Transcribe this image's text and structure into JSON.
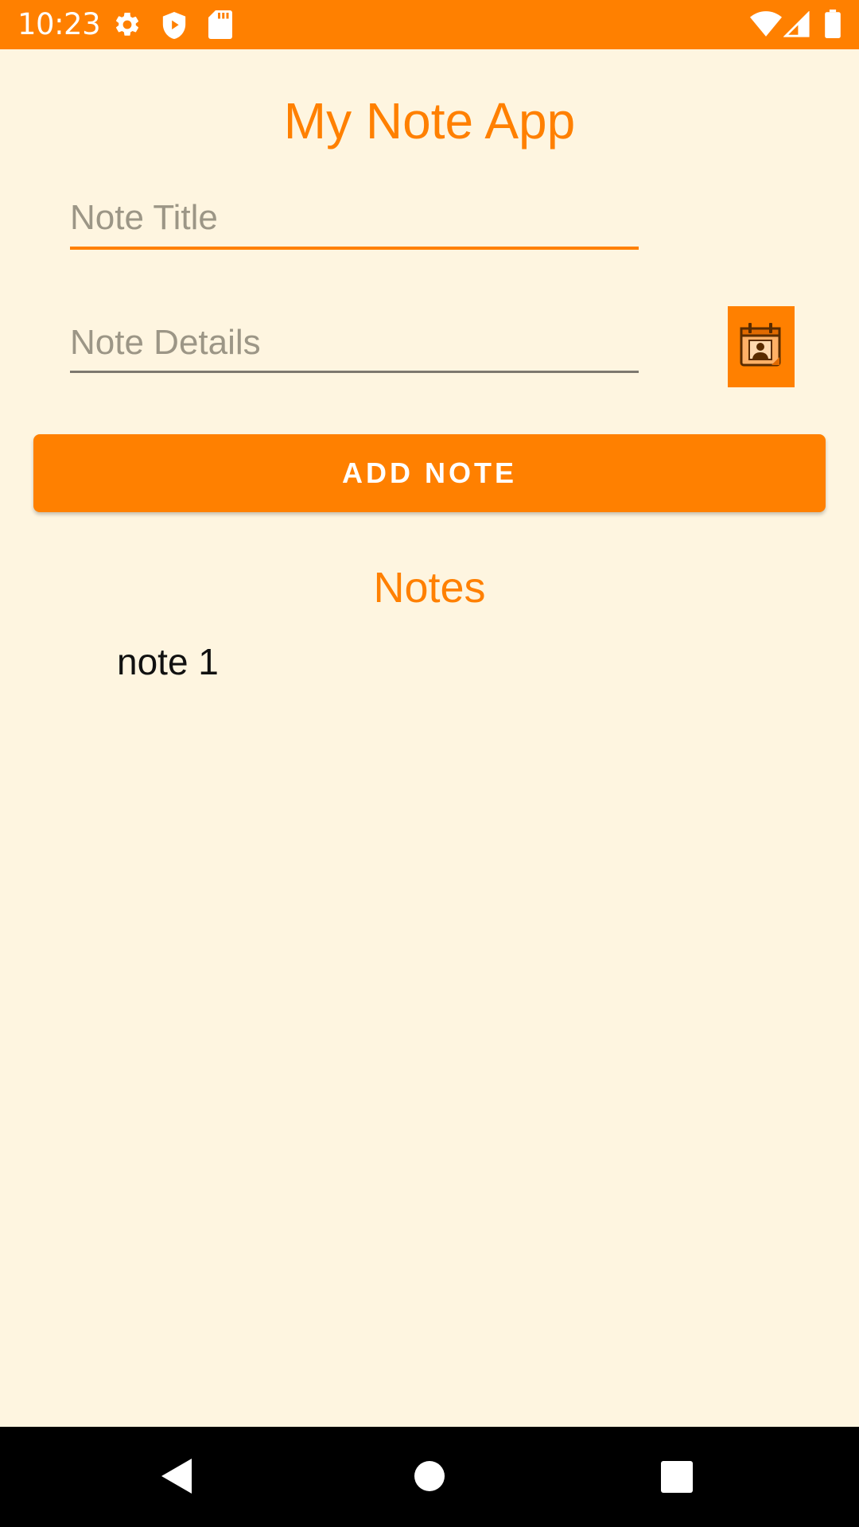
{
  "status_bar": {
    "time": "10:23",
    "icons": [
      "gear-icon",
      "shield-icon",
      "sd-card-icon",
      "wifi-icon",
      "signal-icon",
      "battery-icon"
    ],
    "background_color": "#FF8000"
  },
  "app": {
    "title": "My Note App",
    "accent_color": "#FF8000",
    "background_color": "#FEF5E0"
  },
  "form": {
    "title_field": {
      "value": "",
      "placeholder": "Note Title"
    },
    "details_field": {
      "value": "",
      "placeholder": "Note Details"
    },
    "calendar_button_icon": "calendar-contact-icon",
    "add_button_label": "ADD NOTE"
  },
  "notes": {
    "header": "Notes",
    "items": [
      {
        "label": "note 1"
      }
    ]
  },
  "nav_bar": {
    "icons": [
      "back-icon",
      "home-icon",
      "recents-icon"
    ]
  }
}
